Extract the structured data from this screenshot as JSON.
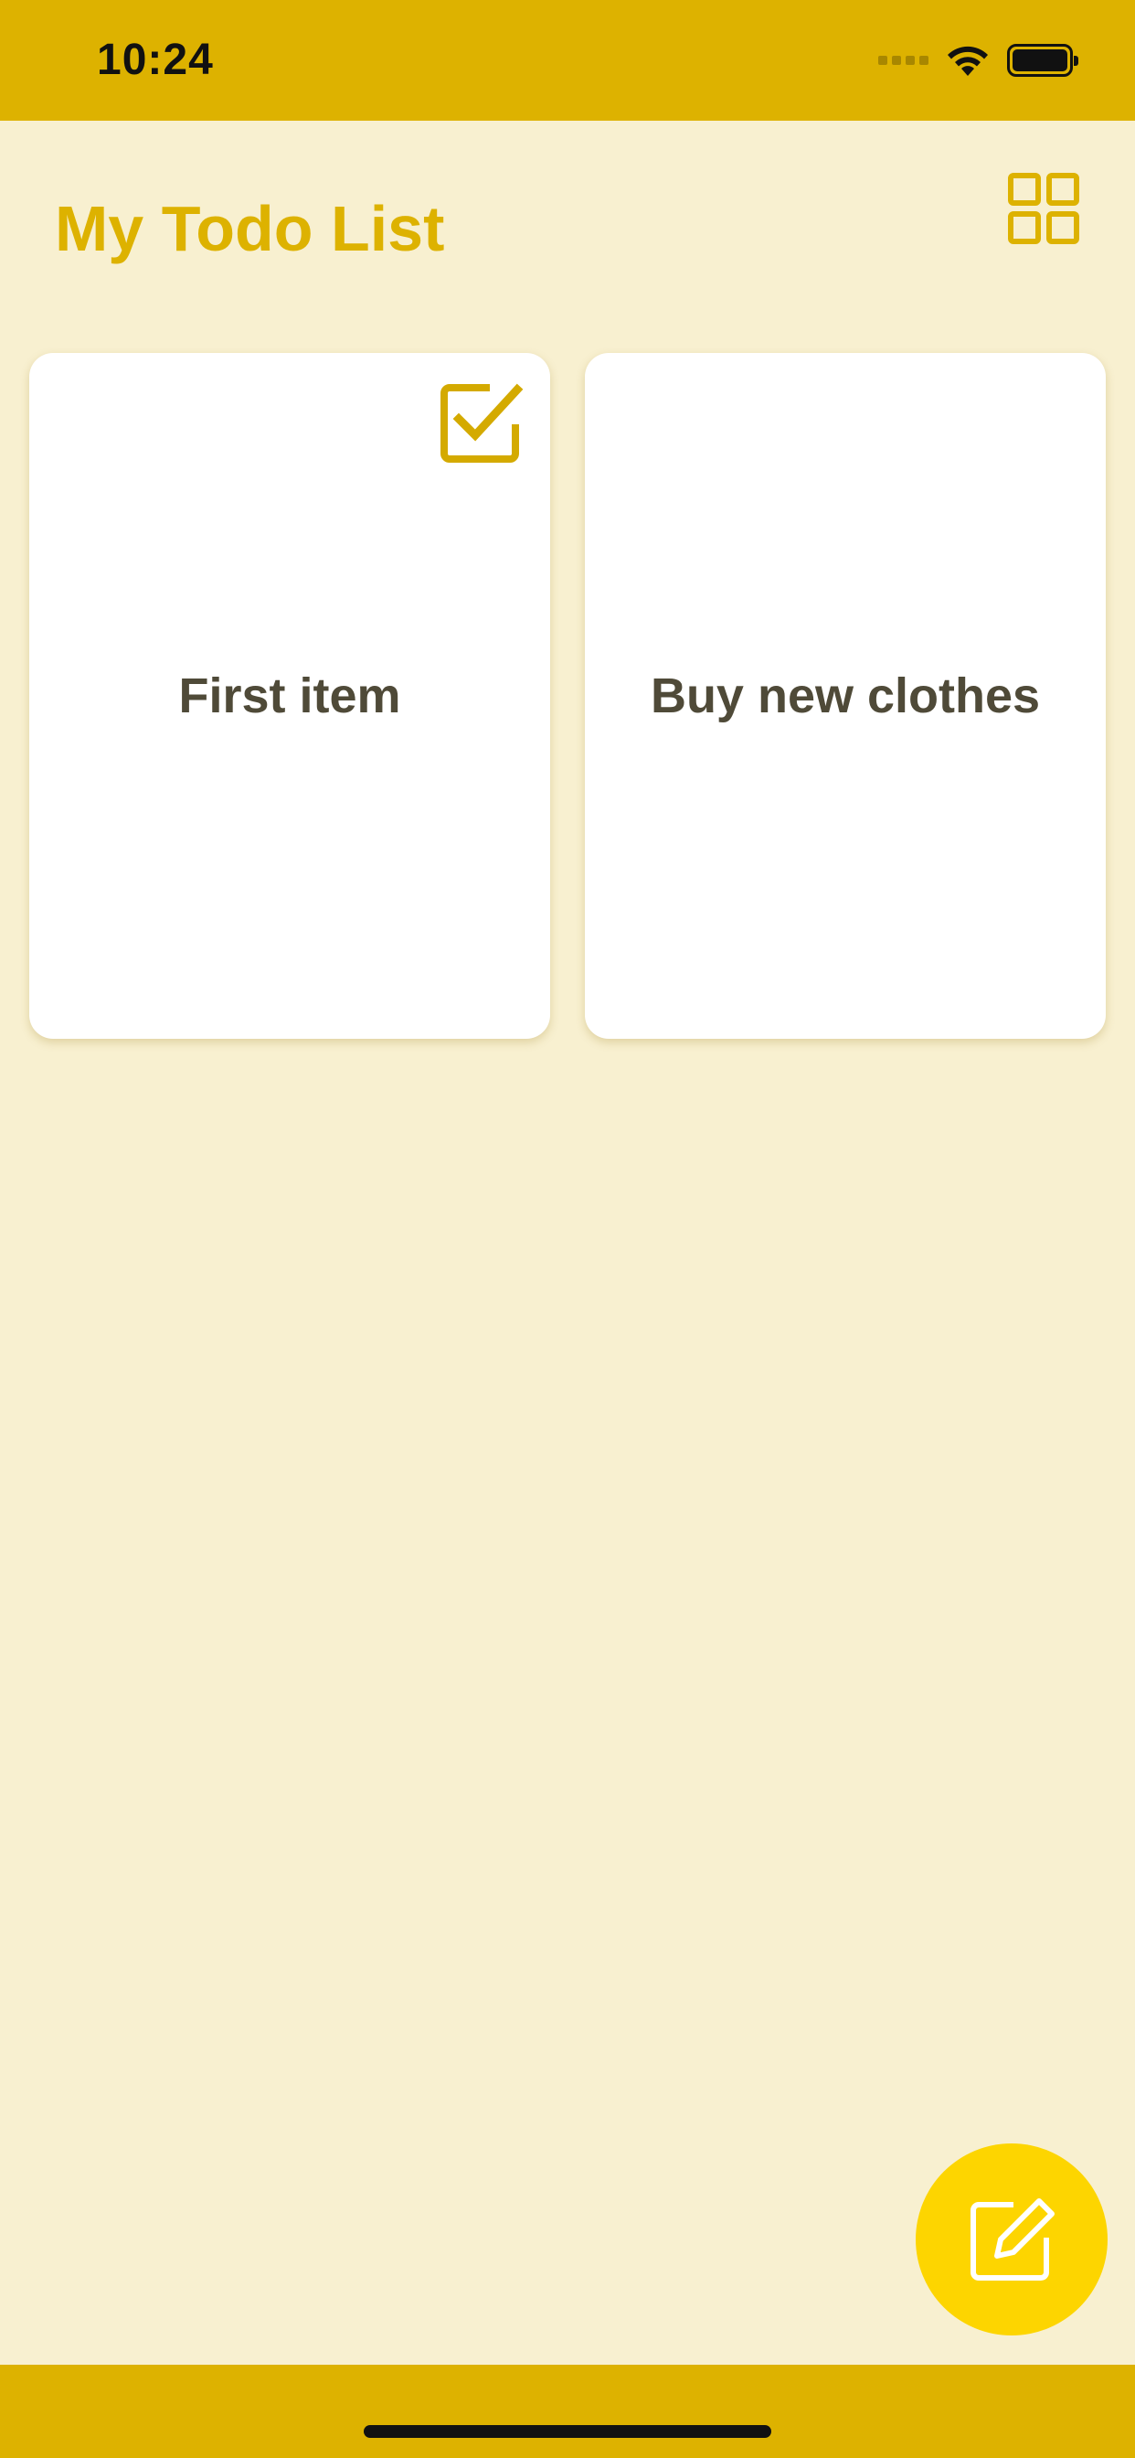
{
  "status_bar": {
    "time": "10:24",
    "signal_icon": "signal-dots-icon",
    "wifi_icon": "wifi-icon",
    "battery_icon": "battery-icon"
  },
  "header": {
    "title": "My Todo List",
    "layout_toggle_icon": "grid-view-icon"
  },
  "todos": [
    {
      "title": "First item",
      "completed": true,
      "status_icon": "checked-checkbox-icon"
    },
    {
      "title": "Buy new clothes",
      "completed": false
    }
  ],
  "fab": {
    "icon": "edit-icon"
  },
  "colors": {
    "accent": "#DDB200",
    "background": "#F8F0D0",
    "card": "#FFFFFF",
    "card_text": "#4F4A38",
    "fab": "#FDD500"
  }
}
